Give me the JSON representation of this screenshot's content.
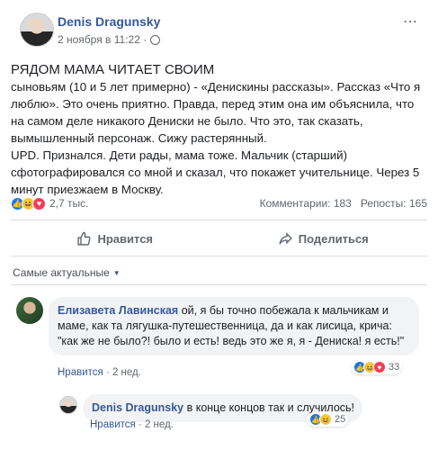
{
  "post": {
    "author": "Denis Dragunsky",
    "date": "2 ноября в 11:22 ·",
    "text_lead": "РЯДОМ МАМА ЧИТАЕТ СВОИМ",
    "text_body": "сыновьям (10 и 5 лет примерно) - «Денискины рассказы». Рассказ «Что я люблю». Это очень приятно. Правда, перед этим она им объяснила, что на самом деле никакого Дениски не было. Что это, так сказать, вымышленный персонаж. Сижу растерянный.",
    "text_upd": "UPD. Признался. Дети рады, мама тоже. Мальчик (старший) сфотографировался со мной и сказал, что покажет учительнице. Через 5 минут приезжаем в Москву.",
    "reactions_count": "2,7 тыс.",
    "comments_count": "Комментарии: 183",
    "shares_count": "Репосты: 165",
    "like_label": "Нравится",
    "share_label": "Поделиться",
    "more_icon": "⋯"
  },
  "comments_sort": "Самые актуальные",
  "comments": [
    {
      "author": "Елизавета Лавинская",
      "text": " ой, я бы точно побежала к мальчикам и маме, как та лягушка-путешественница, да и как лисица, крича: \"как же не было?! было и есть! ведь это же я, я - Дениска! я есть!\"",
      "like": "Нравится",
      "time": " · 2 нед.",
      "reactions": "33"
    },
    {
      "author": "Denis Dragunsky",
      "text": " в конце концов так и случилось!",
      "like": "Нравится",
      "time": " · 2 нед.",
      "reactions": "25"
    }
  ],
  "colors": {
    "link": "#365899",
    "like_reaction": "#1877f2",
    "haha_reaction": "#f7c94b",
    "love_reaction": "#f33e58"
  }
}
